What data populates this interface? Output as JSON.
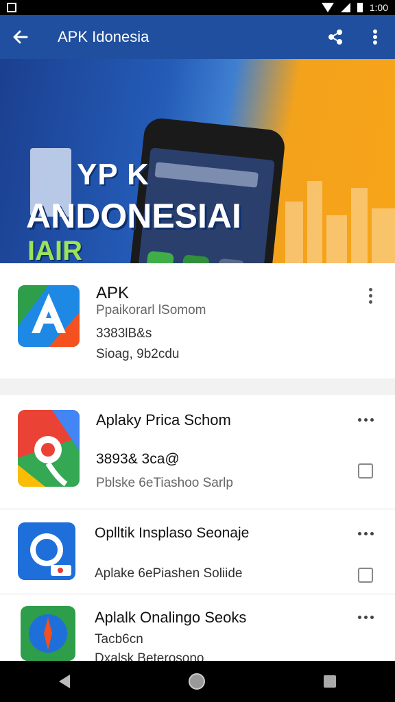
{
  "status_bar": {
    "time": "1:00"
  },
  "app_bar": {
    "title": "APK Idonesia"
  },
  "hero": {
    "line1": "YP K",
    "line2": "ANDONESIAI",
    "line3": "IAIR"
  },
  "featured": {
    "name": "APK",
    "developer": "Ppaikorarl lSomom",
    "size": "3383lB&s",
    "meta": "Sioag, 9b2cdu"
  },
  "apps": [
    {
      "name": "Aplaky Prica Schom",
      "stat": "3893& 3ca@",
      "subtitle": "Pblske 6eTiashoo Sarlp"
    },
    {
      "name": "Oplltik Insplaso Seonaje",
      "subtitle": "Aplake 6ePiashen Soliide"
    },
    {
      "name": "Aplalk Onalingo Seoks",
      "subtitle": "Tacb6cn",
      "extra": "Dxalsk Beterosono"
    }
  ],
  "colors": {
    "appbar": "#1f4f9e",
    "accent": "#f7a418"
  }
}
